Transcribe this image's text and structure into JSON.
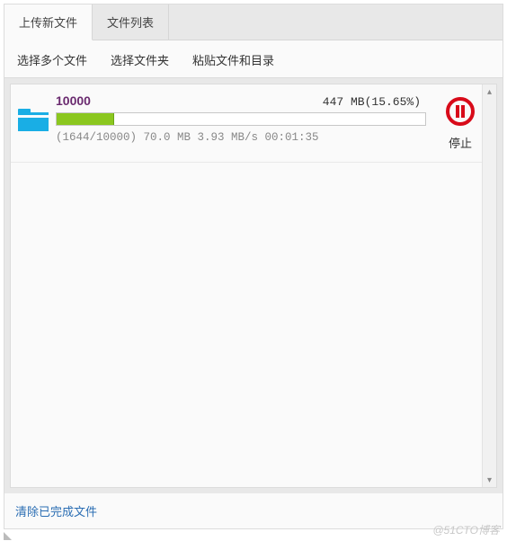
{
  "tabs": {
    "upload_new": "上传新文件",
    "file_list": "文件列表"
  },
  "toolbar": {
    "select_files": "选择多个文件",
    "select_folder": "选择文件夹",
    "paste_files": "粘贴文件和目录"
  },
  "upload": {
    "title": "10000",
    "size_text": "447 MB(15.65%)",
    "progress_percent": 15.65,
    "sub_text": "(1644/10000) 70.0 MB 3.93 MB/s 00:01:35",
    "stop_label": "停止"
  },
  "footer": {
    "clear_done": "清除已完成文件"
  },
  "watermark": "@51CTO博客"
}
